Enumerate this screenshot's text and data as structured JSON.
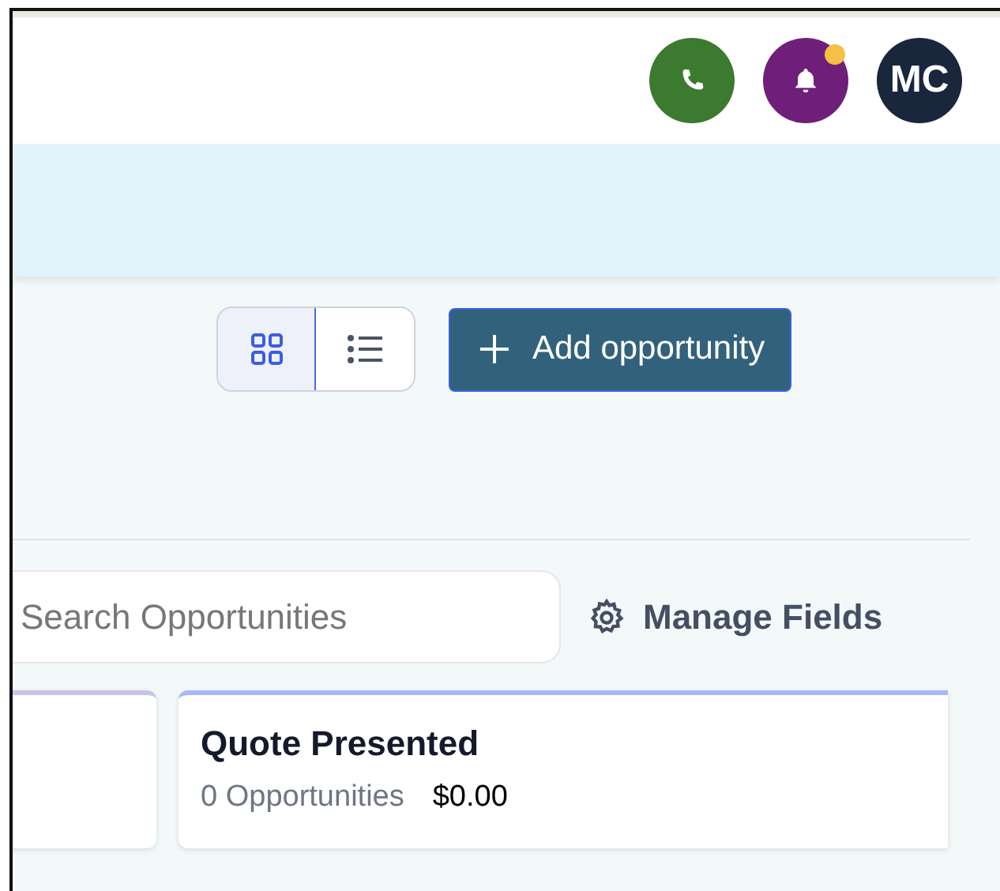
{
  "header": {
    "actions": [
      {
        "kind": "phone"
      },
      {
        "kind": "notifications",
        "unread": true
      },
      {
        "kind": "avatar",
        "initials": "MC"
      }
    ]
  },
  "toolbar": {
    "views": [
      {
        "kind": "grid",
        "selected": true
      },
      {
        "kind": "list",
        "selected": false
      }
    ],
    "add_button": "Add opportunity"
  },
  "search": {
    "placeholder": "Search Opportunities"
  },
  "manage_fields": "Manage Fields",
  "stages": [
    {
      "color": "#c9c3e6"
    },
    {
      "title": "Quote Presented",
      "count": "0 Opportunities",
      "amount": "$0.00",
      "color": "#a8b8f5"
    }
  ]
}
